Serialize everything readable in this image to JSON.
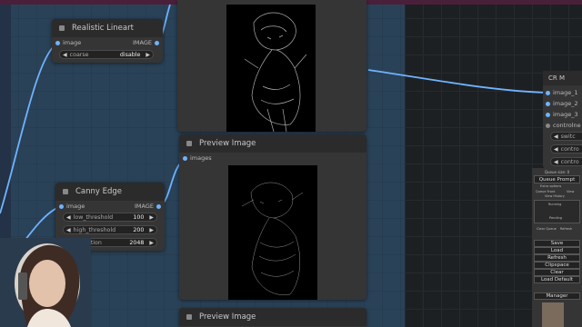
{
  "nodes": {
    "realistic_lineart": {
      "title": "Realistic Lineart",
      "input": "image",
      "output": "IMAGE",
      "widget": {
        "name": "coarse",
        "value": "disable"
      }
    },
    "canny_edge": {
      "title": "Canny Edge",
      "input": "image",
      "output": "IMAGE",
      "widgets": [
        {
          "name": "low_threshold",
          "value": "100"
        },
        {
          "name": "high_threshold",
          "value": "200"
        },
        {
          "name": "resolution",
          "value": "2048"
        }
      ]
    },
    "preview_image_1": {
      "title": "Preview Image",
      "input": "images"
    },
    "preview_image_2": {
      "title": "Preview Image"
    },
    "cr_node": {
      "title": "CR M",
      "inputs": [
        "image_1",
        "image_2",
        "image_3",
        "controlne"
      ],
      "widgets": [
        "switc",
        "contro",
        "contro"
      ]
    }
  },
  "menu": {
    "queue_size": "Queue size: 0",
    "queue_prompt": "Queue Prompt",
    "extra_options": "Extra options",
    "queue_front": "Queue Front",
    "view": "View",
    "view_history": "View History",
    "running": "Running",
    "pending": "Pending",
    "clear_queue": "Clear Queue",
    "refresh_small": "Refresh",
    "buttons": [
      "Save",
      "Load",
      "Refresh",
      "Clipspace",
      "Clear",
      "Load Default"
    ],
    "manager": "Manager"
  },
  "colors": {
    "link_blue": "#6fb3ff",
    "group_bg": "#2a4258",
    "node_bg": "#353535"
  }
}
